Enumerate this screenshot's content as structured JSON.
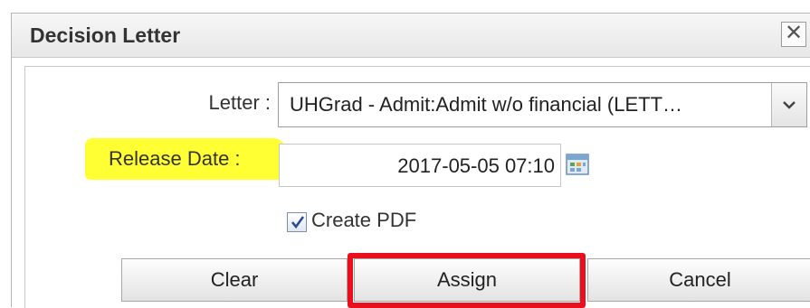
{
  "dialog": {
    "title": "Decision Letter",
    "close_glyph": "✕"
  },
  "form": {
    "letter_label": "Letter :",
    "letter_value": "UHGrad - Admit:Admit w/o financial (LETT…",
    "release_label": "Release Date :",
    "release_value": "2017-05-05 07:10",
    "create_pdf_label": "Create PDF",
    "create_pdf_checked": true
  },
  "buttons": {
    "clear": "Clear",
    "assign": "Assign",
    "cancel": "Cancel"
  },
  "icons": {
    "close": "close-icon",
    "dropdown": "chevron-down-icon",
    "calendar": "calendar-icon",
    "checkmark": "checkmark-icon"
  },
  "colors": {
    "highlight": "#ffff33",
    "annotation_outline": "#e8101c"
  }
}
